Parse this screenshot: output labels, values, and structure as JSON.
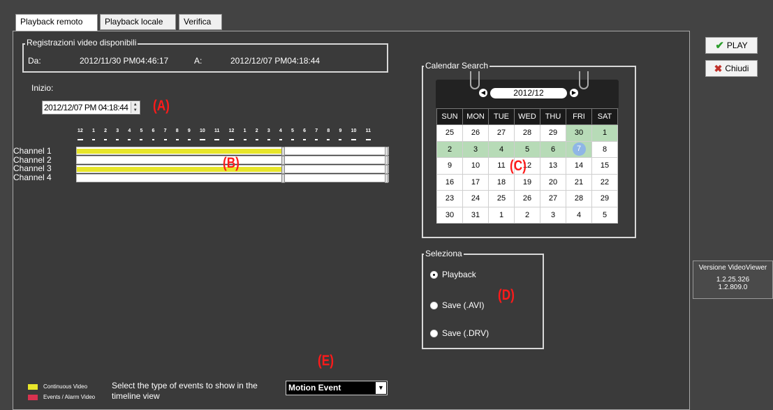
{
  "tabs": [
    "Playback remoto",
    "Playback locale",
    "Verifica"
  ],
  "recordings": {
    "title": "Registrazioni video disponibili",
    "from_label": "Da:",
    "from_value": "2012/11/30 PM04:46:17",
    "to_label": "A:",
    "to_value": "2012/12/07 PM04:18:44"
  },
  "start": {
    "label": "Inizio:",
    "value": "2012/12/07 PM 04:18:44"
  },
  "timeline": {
    "hours": [
      "12",
      "1",
      "2",
      "3",
      "4",
      "5",
      "6",
      "7",
      "8",
      "9",
      "10",
      "11",
      "12",
      "1",
      "2",
      "3",
      "4",
      "5",
      "6",
      "7",
      "8",
      "9",
      "10",
      "11"
    ],
    "channels": [
      {
        "label": "Channel 1",
        "continuous": true
      },
      {
        "label": "Channel 2",
        "continuous": false
      },
      {
        "label": "Channel 3",
        "continuous": true
      },
      {
        "label": "Channel 4",
        "continuous": false
      }
    ]
  },
  "calendar": {
    "title": "Calendar Search",
    "month": "2012/12",
    "weekdays": [
      "SUN",
      "MON",
      "TUE",
      "WED",
      "THU",
      "FRI",
      "SAT"
    ],
    "weeks": [
      [
        "25",
        "26",
        "27",
        "28",
        "29",
        "30",
        "1"
      ],
      [
        "2",
        "3",
        "4",
        "5",
        "6",
        "7",
        "8"
      ],
      [
        "9",
        "10",
        "11",
        "12",
        "13",
        "14",
        "15"
      ],
      [
        "16",
        "17",
        "18",
        "19",
        "20",
        "21",
        "22"
      ],
      [
        "23",
        "24",
        "25",
        "26",
        "27",
        "28",
        "29"
      ],
      [
        "30",
        "31",
        "1",
        "2",
        "3",
        "4",
        "5"
      ]
    ],
    "highlighted": [
      "0-5",
      "0-6",
      "1-0",
      "1-1",
      "1-2",
      "1-3",
      "1-4"
    ],
    "selected": "1-5"
  },
  "select": {
    "title": "Seleziona",
    "options": [
      "Playback",
      "Save (.AVI)",
      "Save (.DRV)"
    ],
    "selected_index": 0
  },
  "buttons": {
    "play": "PLAY",
    "close": "Chiudi"
  },
  "version": {
    "title": "Versione VideoViewer",
    "line1": "1.2.25.326",
    "line2": "1.2.809.0"
  },
  "legend": {
    "continuous": "Continuous Video",
    "events": "Events / Alarm Video",
    "continuous_color": "#e8e62a",
    "events_color": "#d8324f"
  },
  "event_type": {
    "prompt": "Select the type of events to show in the timeline view",
    "value": "Motion Event"
  },
  "markers": {
    "a": "(A)",
    "b": "(B)",
    "c": "(C)",
    "d": "(D)",
    "e": "(E)"
  },
  "colors": {
    "background": "#434343",
    "timeline_fill": "#e8e62a",
    "calendar_highlight": "#b7dbb7",
    "calendar_today": "#8fb6e6",
    "marker": "#ff1a1a"
  }
}
